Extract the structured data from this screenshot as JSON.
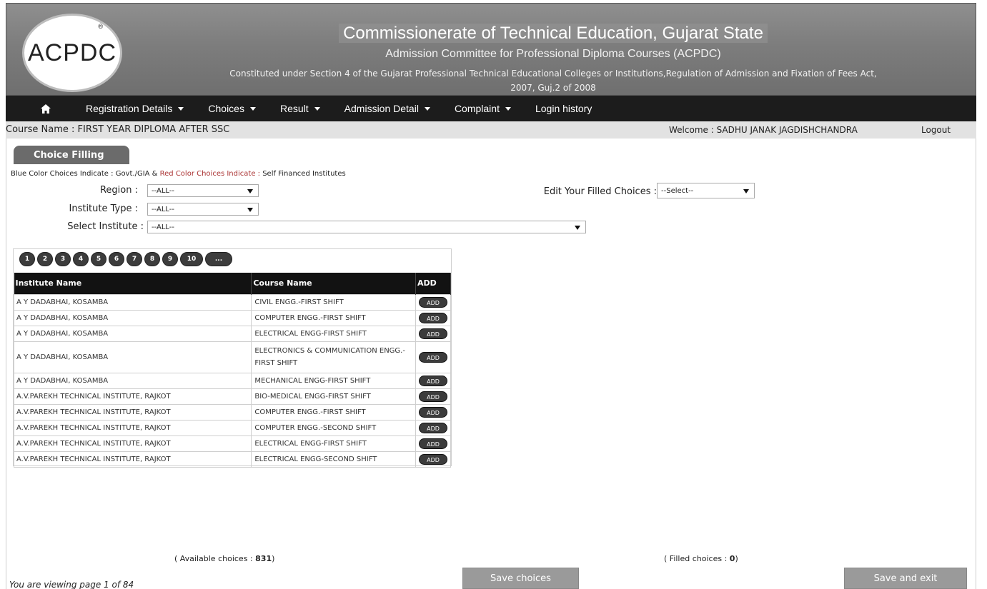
{
  "header": {
    "logo_text": "ACPDC",
    "title": "Commissionerate of Technical Education, Gujarat State",
    "subtitle": "Admission Committee for Professional Diploma Courses (ACPDC)",
    "act_line1": "Constituted under Section 4 of the Gujarat Professional Technical Educational Colleges or Institutions,Regulation of Admission and Fixation of Fees Act,",
    "act_line2": "2007, Guj.2 of 2008"
  },
  "nav": {
    "items": [
      "Registration Details",
      "Choices",
      "Result",
      "Admission Detail",
      "Complaint",
      "Login history"
    ]
  },
  "infobar": {
    "course": "Course Name : FIRST YEAR DIPLOMA AFTER SSC",
    "welcome": "Welcome : SADHU JANAK JAGDISHCHANDRA",
    "logout": "Logout"
  },
  "choice_filling": {
    "tab": "Choice Filling",
    "legend_part1": "Blue Color Choices Indicate : Govt./GIA & ",
    "legend_part2": "Red Color Choices Indicate : ",
    "legend_part3": "Self Financed Institutes",
    "region_label": "Region :",
    "region_value": "--ALL--",
    "type_label": "Institute Type :",
    "type_value": "--ALL--",
    "institute_label": "Select Institute :",
    "institute_value": "--ALL--",
    "edit_label": "Edit Your Filled Choices :",
    "edit_value": "--Select--"
  },
  "pager": [
    "1",
    "2",
    "3",
    "4",
    "5",
    "6",
    "7",
    "8",
    "9",
    "10",
    "..."
  ],
  "table": {
    "headers": [
      "Institute Name",
      "Course Name",
      "ADD"
    ],
    "add_label": "ADD",
    "rows": [
      {
        "institute": "A Y DADABHAI, KOSAMBA",
        "course": "CIVIL ENGG.-FIRST SHIFT"
      },
      {
        "institute": "A Y DADABHAI, KOSAMBA",
        "course": "COMPUTER ENGG.-FIRST SHIFT"
      },
      {
        "institute": "A Y DADABHAI, KOSAMBA",
        "course": "ELECTRICAL ENGG-FIRST SHIFT"
      },
      {
        "institute": "A Y DADABHAI, KOSAMBA",
        "course": "ELECTRONICS & COMMUNICATION ENGG.-FIRST SHIFT"
      },
      {
        "institute": "A Y DADABHAI, KOSAMBA",
        "course": "MECHANICAL ENGG-FIRST SHIFT"
      },
      {
        "institute": "A.V.PAREKH TECHNICAL INSTITUTE, RAJKOT",
        "course": "BIO-MEDICAL ENGG-FIRST SHIFT"
      },
      {
        "institute": "A.V.PAREKH TECHNICAL INSTITUTE, RAJKOT",
        "course": "COMPUTER ENGG.-FIRST SHIFT"
      },
      {
        "institute": "A.V.PAREKH TECHNICAL INSTITUTE, RAJKOT",
        "course": "COMPUTER ENGG.-SECOND SHIFT"
      },
      {
        "institute": "A.V.PAREKH TECHNICAL INSTITUTE, RAJKOT",
        "course": "ELECTRICAL ENGG-FIRST SHIFT"
      },
      {
        "institute": "A.V.PAREKH TECHNICAL INSTITUTE, RAJKOT",
        "course": "ELECTRICAL ENGG-SECOND SHIFT"
      }
    ]
  },
  "footer": {
    "available_prefix": "( Available choices : ",
    "available_count": "831",
    "available_suffix": ")",
    "filled_prefix": "( Filled choices : ",
    "filled_count": "0",
    "filled_suffix": ")",
    "page_info": "You are viewing page 1 of 84",
    "save_choices": "Save choices",
    "save_exit": "Save and exit"
  }
}
